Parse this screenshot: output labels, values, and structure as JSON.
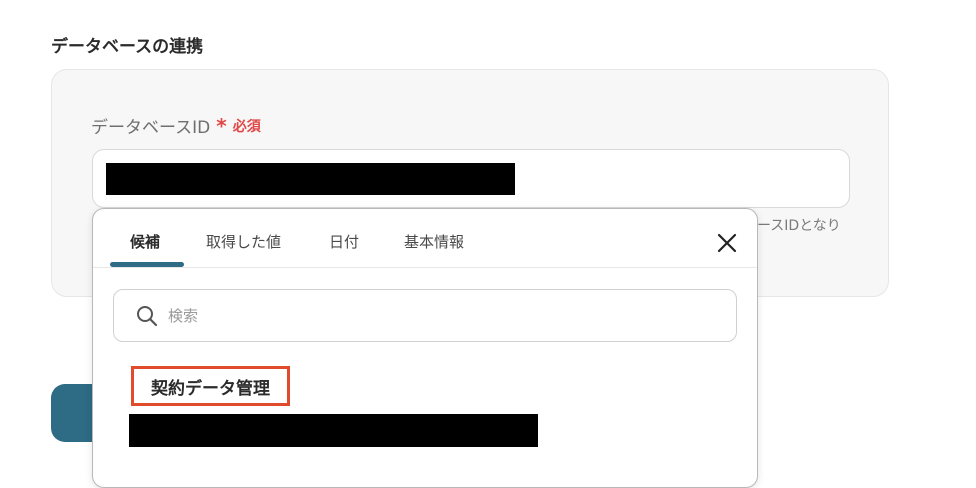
{
  "section": {
    "title": "データベースの連携"
  },
  "field": {
    "label": "データベースID",
    "required_mark": "*",
    "required_text": "必須",
    "helper_text": "ースIDとなり"
  },
  "popup": {
    "tabs": [
      {
        "label": "候補",
        "active": true
      },
      {
        "label": "取得した値",
        "active": false
      },
      {
        "label": "日付",
        "active": false
      },
      {
        "label": "基本情報",
        "active": false
      }
    ],
    "search": {
      "placeholder": "検索"
    },
    "results": [
      {
        "title": "契約データ管理"
      }
    ]
  },
  "colors": {
    "accent": "#2e6b84",
    "required": "#e04848",
    "highlight": "#e04b2b"
  },
  "icons": {
    "close": "close-icon",
    "search": "search-icon"
  }
}
